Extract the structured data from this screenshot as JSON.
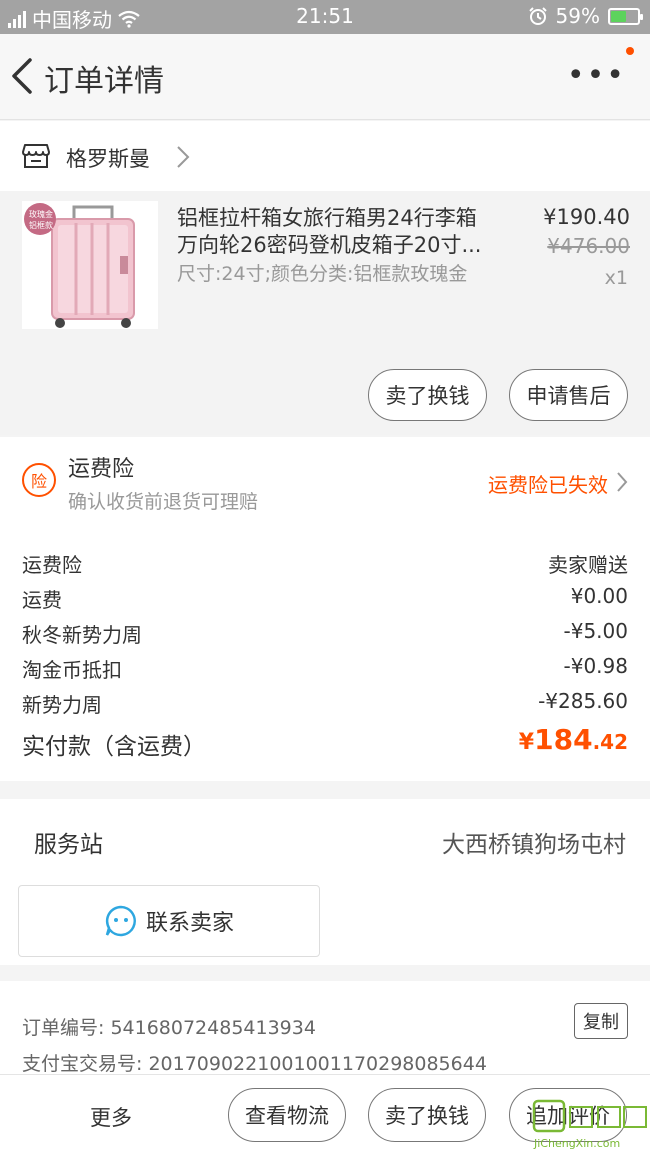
{
  "status_bar": {
    "carrier": "中国移动",
    "time": "21:51",
    "battery": "59%",
    "battery_level": 0.59
  },
  "header": {
    "title": "订单详情",
    "more_label": "•••"
  },
  "shop": {
    "name": "格罗斯曼"
  },
  "product": {
    "title": "铝框拉杆箱女旅行箱男24行李箱万向轮26密码登机皮箱子20寸...",
    "sku": "尺寸:24寸;颜色分类:铝框款玫瑰金",
    "price": "¥190.40",
    "original_price": "¥476.00",
    "quantity": "x1",
    "image_tag_line1": "玫瑰金",
    "image_tag_line2": "铝框款",
    "sell_button": "卖了换钱",
    "after_sale_button": "申请售后"
  },
  "insurance": {
    "badge": "险",
    "title": "运费险",
    "subtitle": "确认收货前退货可理赔",
    "status": "运费险已失效"
  },
  "fees": [
    {
      "label": "运费险",
      "value": "卖家赠送"
    },
    {
      "label": "运费",
      "value": "¥0.00"
    },
    {
      "label": "秋冬新势力周",
      "value": "-¥5.00"
    },
    {
      "label": "淘金币抵扣",
      "value": "-¥0.98"
    },
    {
      "label": "新势力周",
      "value": "-¥285.60"
    }
  ],
  "total": {
    "label": "实付款（含运费）",
    "currency": "¥",
    "integer": "184",
    "decimal": ".42"
  },
  "service": {
    "label": "服务站",
    "value": "大西桥镇狗场屯村",
    "contact_button": "联系卖家"
  },
  "order_info": {
    "order_no": "订单编号: 54168072485413934",
    "alipay_no": "支付宝交易号: 2017090221001001170298085644",
    "copy_button": "复制"
  },
  "bottom_bar": {
    "more": "更多",
    "logistics": "查看物流",
    "sell": "卖了换钱",
    "review": "追加评价"
  },
  "watermark": {
    "text": "JiChengXin.com"
  }
}
